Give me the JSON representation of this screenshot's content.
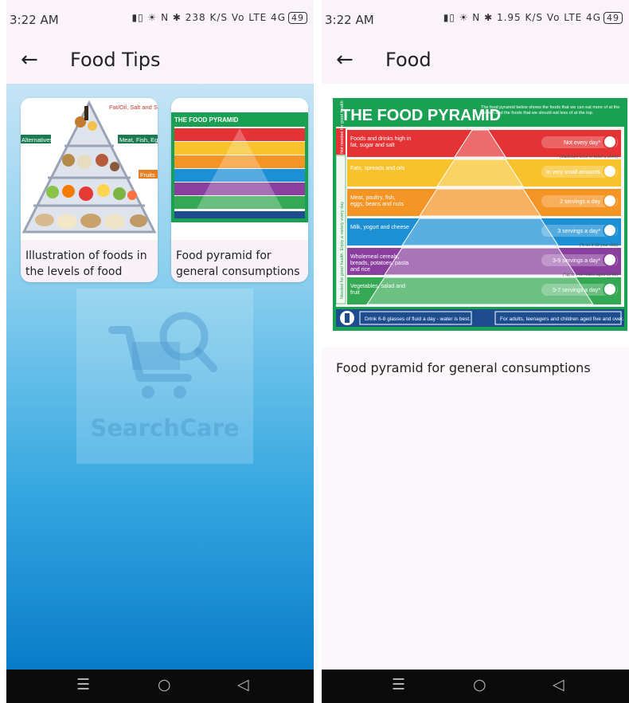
{
  "status": {
    "time": "3:22 AM",
    "icons": "▮▯ ☀ N ✱ ",
    "left_speed": "238",
    "right_speed": "1.95",
    "speed_unit": "K/S",
    "net": "Vo LTE 4G",
    "battery": "49"
  },
  "left": {
    "appbar": {
      "title": "Food Tips"
    },
    "cards": [
      {
        "caption": "Illustration of foods in the levels of food pyramid",
        "labels": [
          "Fat/Oil, Salt and Sugar",
          "Alternatives",
          "Meat, Fish, Egg",
          "Fruits"
        ]
      },
      {
        "caption": "Food pyramid for general consumptions",
        "title": "THE FOOD PYRAMID"
      }
    ],
    "watermark": {
      "brand": "SearchCare"
    }
  },
  "right": {
    "appbar": {
      "title": "Food"
    },
    "poster": {
      "title": "THE FOOD PYRAMID",
      "intro": "The food pyramid below shows the foods that we can eat more of at the bottom and the foods that we should eat less of at the top.",
      "side_top": "Not needed for good health",
      "side_bottom": "Needed for good health. Enjoy a variety every day.",
      "levels": [
        {
          "name": "Foods and drinks high in fat, sugar and salt",
          "serving": "Not every day*",
          "note": "(Maximum once or twice a week)",
          "color": "#e53235"
        },
        {
          "name": "Fats, spreads and oils",
          "serving": "In very small amounts",
          "note": "",
          "color": "#f7c22b"
        },
        {
          "name": "Meat, poultry, fish, eggs, beans and nuts",
          "serving": "2 servings a day",
          "note": "",
          "color": "#f49425"
        },
        {
          "name": "Milk, yogurt and cheese",
          "serving": "3 servings a day*",
          "note": "(*5 for 9-18 year olds)",
          "color": "#1d8fd4"
        },
        {
          "name": "Wholemeal cereals, breads, potatoes, pasta and rice",
          "serving": "3-5 servings a day*",
          "note": "(*up to 7 for males aged 19-50)",
          "color": "#8a3f9e"
        },
        {
          "name": "Vegetables, salad and fruit",
          "serving": "5-7 servings a day*",
          "note": "",
          "color": "#34a853"
        }
      ],
      "footer_left": "Drink 6-8 glasses of fluid a day - water is best.",
      "footer_right": "For adults, teenagers and children aged five and over."
    },
    "caption": "Food pyramid for general consumptions"
  },
  "nav": {
    "menu_icon": "☰",
    "home_icon": "○",
    "back_icon": "◁"
  },
  "colors": {
    "header": "#1aa053",
    "accent": "#0a7bc9"
  }
}
